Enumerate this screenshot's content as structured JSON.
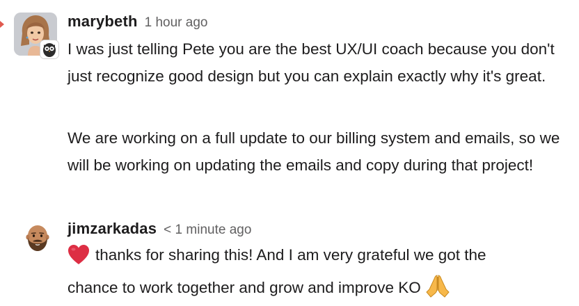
{
  "messages": [
    {
      "username": "marybeth",
      "timestamp": "1 hour ago",
      "paragraphs": [
        "I was just telling Pete you are the best UX/UI coach because you don't just recognize good design but you can explain exactly why it's great.",
        "We are working on a full update to our billing system and emails, so we will be working on updating the emails and copy during that project!"
      ],
      "avatar_icon": "woman-avatar",
      "badge_icon": "owl-icon"
    },
    {
      "username": "jimzarkadas",
      "timestamp": "< 1 minute ago",
      "text_after_heart": "thanks for sharing this! And I am very grateful we got the",
      "text_line2": "chance to work together and grow and improve KO",
      "avatar_icon": "bald-bearded-man-emoji",
      "leading_emoji": "red-heart-icon",
      "trailing_emoji": "folded-hands-icon"
    }
  ],
  "colors": {
    "text": "#1d1c1d",
    "timestamp": "#616061",
    "heart": "#dd2e44",
    "pray": "#f7b84a",
    "edge_mark": "#e05a4f"
  }
}
